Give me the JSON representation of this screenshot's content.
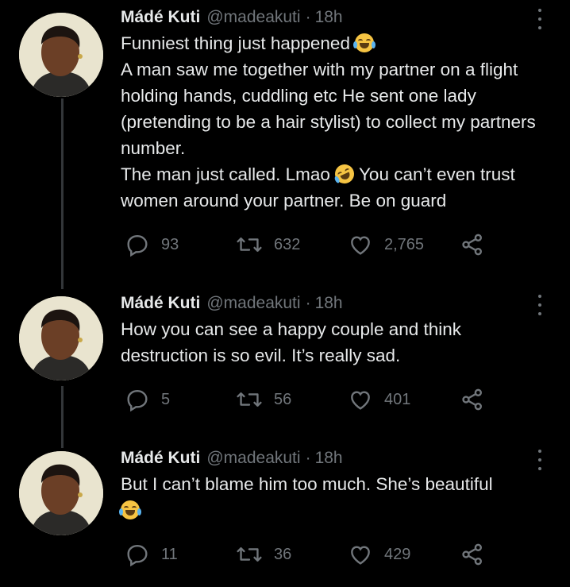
{
  "colors": {
    "background": "#000000",
    "text": "#e7e9ea",
    "muted": "#71767b",
    "thread_line": "#333639"
  },
  "tweets": [
    {
      "author": {
        "name": "Mádé Kuti",
        "handle": "@madeakuti"
      },
      "time": "18h",
      "separator": "·",
      "text_parts": [
        "Funniest thing just happened ",
        "\nA man saw me together with my partner on a flight holding hands, cuddling etc He sent one lady (pretending to be a hair stylist) to collect my partners number.\nThe man just called. Lmao ",
        " You can’t even trust women around your partner. Be on guard"
      ],
      "emojis": [
        "face-with-tears-of-joy",
        "rolling-on-the-floor-laughing"
      ],
      "stats": {
        "replies": "93",
        "retweets": "632",
        "likes": "2,765"
      }
    },
    {
      "author": {
        "name": "Mádé Kuti",
        "handle": "@madeakuti"
      },
      "time": "18h",
      "separator": "·",
      "text_parts": [
        "How you can see a happy couple and think destruction is so evil. It’s really sad."
      ],
      "emojis": [],
      "stats": {
        "replies": "5",
        "retweets": "56",
        "likes": "401"
      }
    },
    {
      "author": {
        "name": "Mádé Kuti",
        "handle": "@madeakuti"
      },
      "time": "18h",
      "separator": "·",
      "text_parts": [
        "But I can’t blame him too much. She’s beautiful\n",
        ""
      ],
      "emojis": [
        "face-with-tears-of-joy"
      ],
      "stats": {
        "replies": "11",
        "retweets": "36",
        "likes": "429"
      }
    }
  ],
  "icons": [
    "reply-icon",
    "retweet-icon",
    "like-icon",
    "share-icon",
    "more-icon"
  ]
}
